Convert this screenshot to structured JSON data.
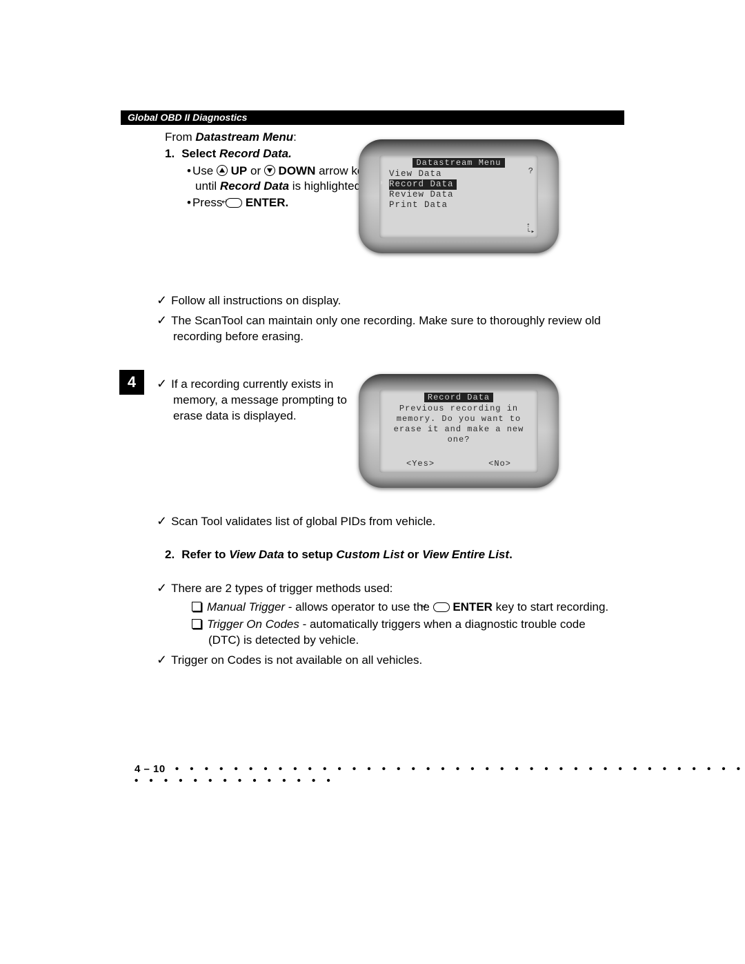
{
  "header": {
    "title": "Global OBD II Diagnostics"
  },
  "intro": {
    "from": "From ",
    "menu": "Datastream Menu",
    "colon": ":"
  },
  "step1": {
    "num": "1.",
    "label_a": "Select ",
    "label_b": "Record Data.",
    "line1_a": "Use ",
    "line1_b": " UP",
    "line1_c": " or ",
    "line1_d": " DOWN",
    "line1_e": " arrow key until ",
    "line1_f": "Record Data",
    "line1_g": " is highlighted.",
    "line2_a": "Press ",
    "line2_b": " ENTER."
  },
  "screen1": {
    "title": "Datastream Menu",
    "items": [
      "View Data",
      "Record Data",
      "Review Data",
      "Print Data"
    ],
    "selected": 1,
    "q": "?",
    "scroll": "⇡\n└▸"
  },
  "checks_a": [
    "Follow all instructions on display.",
    "The ScanTool can maintain only one recording. Make sure to thoroughly review old recording before erasing."
  ],
  "check_b": "If a recording currently exists in memory, a message prompting to erase data is displayed.",
  "screen2": {
    "title": "Record Data",
    "msg": "Previous recording in memory. Do you want to erase it and make a new one?",
    "yes": "<Yes>",
    "no": "<No>"
  },
  "check_c": "Scan Tool validates list of global PIDs from vehicle.",
  "step2": {
    "num": "2.",
    "a": "Refer to ",
    "b": "View Data",
    "c": " to setup ",
    "d": "Custom List",
    "e": " or ",
    "f": "View Entire List",
    "g": "."
  },
  "check_d": "There are 2 types of trigger methods used:",
  "trigger1": {
    "name": "Manual Trigger",
    "sep": " - allows operator to use the ",
    "btn": " ENTER",
    "rest": " key to start recording."
  },
  "trigger2": {
    "name": "Trigger On Codes",
    "rest": " - automatically triggers when a diagnostic trouble code (DTC) is detected by vehicle."
  },
  "check_e": "Trigger on Codes is not available on all vehicles.",
  "tab": "4",
  "footer": {
    "page": "4 – 10"
  }
}
